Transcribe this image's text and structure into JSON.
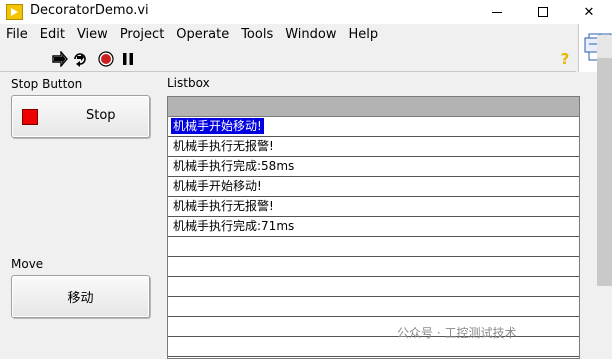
{
  "window": {
    "title": "DecoratorDemo.vi",
    "min_glyph": "",
    "max_glyph": "",
    "close_glyph": "✕"
  },
  "menu": [
    "File",
    "Edit",
    "View",
    "Project",
    "Operate",
    "Tools",
    "Window",
    "Help"
  ],
  "toolbar": {
    "icons": [
      "run-arrow-icon",
      "run-continuously-icon",
      "abort-execution-icon",
      "pause-icon",
      "context-help-icon"
    ],
    "help_glyph": "?"
  },
  "panel": {
    "stop_label": "Stop Button",
    "stop_button_text": "Stop",
    "listbox_label": "Listbox",
    "move_label": "Move",
    "move_button_text": "移动"
  },
  "listbox": {
    "items": [
      "机械手开始移动!",
      "机械手执行无报警!",
      "机械手执行完成:58ms",
      "机械手开始移动!",
      "机械手执行无报警!",
      "机械手执行完成:71ms",
      "",
      "",
      "",
      "",
      "",
      ""
    ],
    "selected_index": 0
  },
  "watermark": "公众号 · 工控测试技术",
  "colors": {
    "selection": "#0000e0",
    "stop_indicator": "#ee0000",
    "help": "#e6b800"
  }
}
